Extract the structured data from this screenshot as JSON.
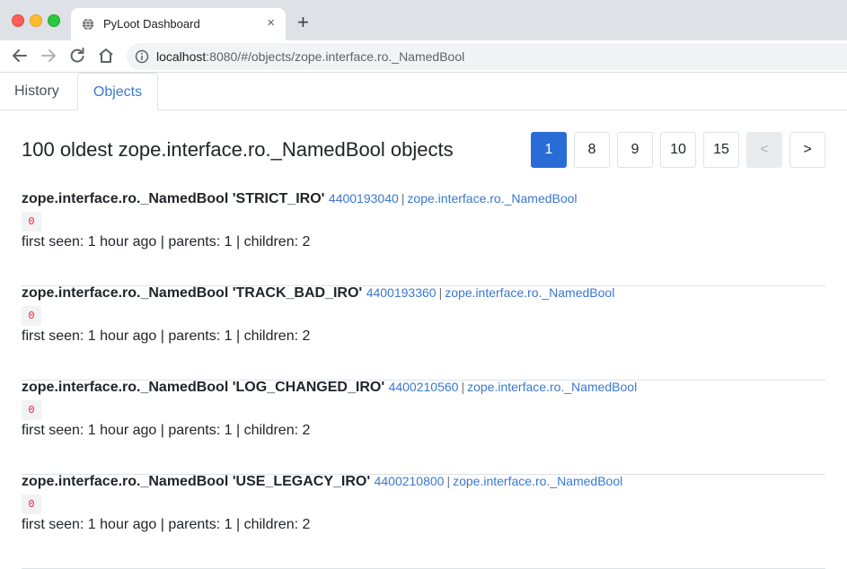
{
  "browser": {
    "tab_title": "PyLoot Dashboard",
    "tab_close": "×",
    "new_tab": "+",
    "url_host": "localhost",
    "url_path": ":8080/#/objects/zope.interface.ro._NamedBool"
  },
  "app_tabs": [
    {
      "label": "History",
      "active": false
    },
    {
      "label": "Objects",
      "active": true
    }
  ],
  "page_title": "100 oldest zope.interface.ro._NamedBool objects",
  "pagination": [
    "1",
    "8",
    "9",
    "10",
    "15",
    "<",
    ">"
  ],
  "objects": [
    {
      "name": "zope.interface.ro._NamedBool 'STRICT_IRO'",
      "id": "4400193040",
      "sep": "|",
      "type_link": "zope.interface.ro._NamedBool",
      "badge": "0",
      "meta": "first seen: 1 hour ago | parents: 1 | children: 2"
    },
    {
      "name": "zope.interface.ro._NamedBool 'TRACK_BAD_IRO'",
      "id": "4400193360",
      "sep": "|",
      "type_link": "zope.interface.ro._NamedBool",
      "badge": "0",
      "meta": "first seen: 1 hour ago | parents: 1 | children: 2"
    },
    {
      "name": "zope.interface.ro._NamedBool 'LOG_CHANGED_IRO'",
      "id": "4400210560",
      "sep": "|",
      "type_link": "zope.interface.ro._NamedBool",
      "badge": "0",
      "meta": "first seen: 1 hour ago | parents: 1 | children: 2"
    },
    {
      "name": "zope.interface.ro._NamedBool 'USE_LEGACY_IRO'",
      "id": "4400210800",
      "sep": "|",
      "type_link": "zope.interface.ro._NamedBool",
      "badge": "0",
      "meta": "first seen: 1 hour ago | parents: 1 | children: 2"
    }
  ],
  "colors": {
    "accent": "#2a6cd6",
    "link": "#3a78d0",
    "badge_text": "#e3233d"
  }
}
